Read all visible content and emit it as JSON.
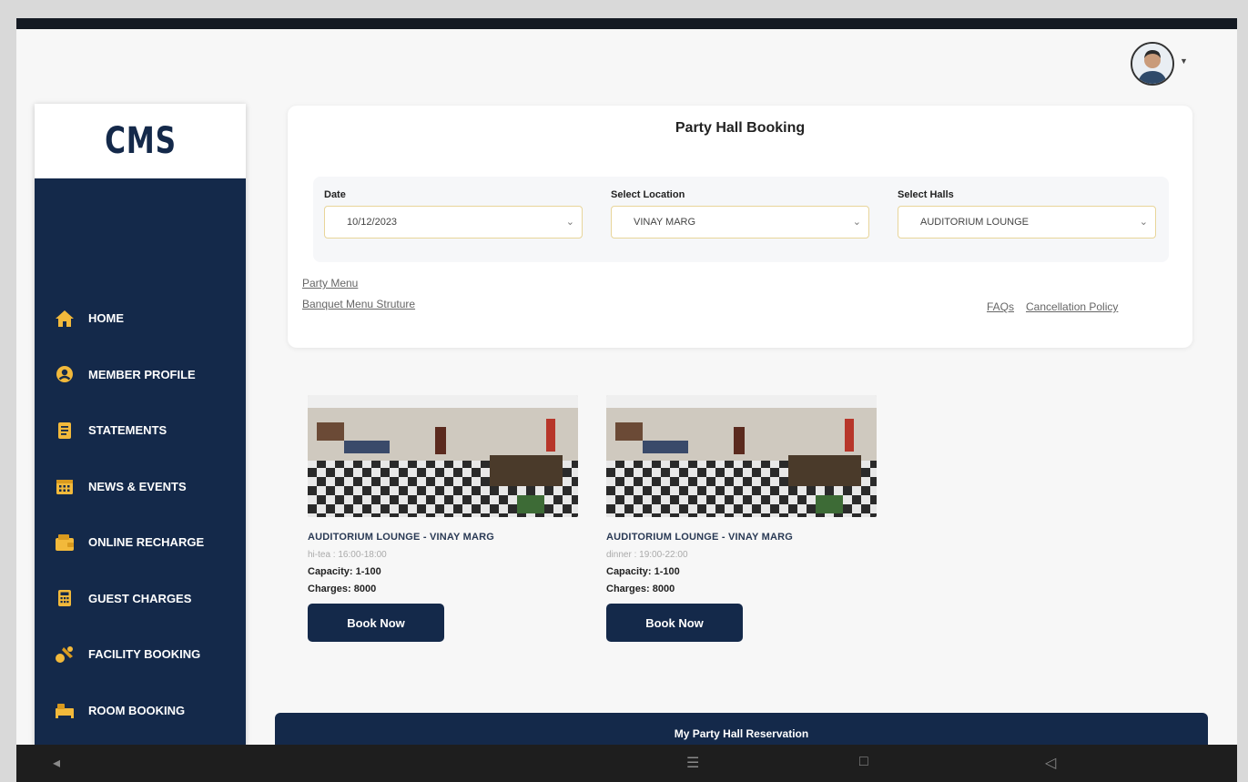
{
  "app": {
    "logo_text": "CMS"
  },
  "sidebar": {
    "items": [
      {
        "label": "HOME",
        "icon": "home-icon"
      },
      {
        "label": "MEMBER PROFILE",
        "icon": "user-circle-icon"
      },
      {
        "label": "STATEMENTS",
        "icon": "document-icon"
      },
      {
        "label": "NEWS & EVENTS",
        "icon": "calendar-icon"
      },
      {
        "label": "ONLINE RECHARGE",
        "icon": "wallet-icon"
      },
      {
        "label": "GUEST CHARGES",
        "icon": "calculator-icon"
      },
      {
        "label": "FACILITY BOOKING",
        "icon": "facility-icon"
      },
      {
        "label": "ROOM BOOKING",
        "icon": "room-icon"
      }
    ]
  },
  "booking": {
    "title": "Party Hall Booking",
    "date": {
      "label": "Date",
      "value": "10/12/2023"
    },
    "location": {
      "label": "Select Location",
      "value": "VINAY MARG"
    },
    "halls": {
      "label": "Select Halls",
      "value": "AUDITORIUM LOUNGE"
    },
    "links": {
      "party_menu": "Party Menu",
      "banquet_menu": "Banquet Menu Struture",
      "faqs": "FAQs",
      "cancellation": "Cancellation Policy"
    }
  },
  "halls": [
    {
      "name": "AUDITORIUM LOUNGE - VINAY MARG",
      "time": "hi-tea : 16:00-18:00",
      "capacity": "Capacity: 1-100",
      "charges": "Charges: 8000",
      "button": "Book Now"
    },
    {
      "name": "AUDITORIUM LOUNGE - VINAY MARG",
      "time": "dinner : 19:00-22:00",
      "capacity": "Capacity: 1-100",
      "charges": "Charges: 8000",
      "button": "Book Now"
    }
  ],
  "reservation": {
    "title": "My Party Hall Reservation"
  },
  "colors": {
    "primary": "#14294a",
    "accent_border": "#e8d59a",
    "icon_gold": "#f2b93b"
  }
}
